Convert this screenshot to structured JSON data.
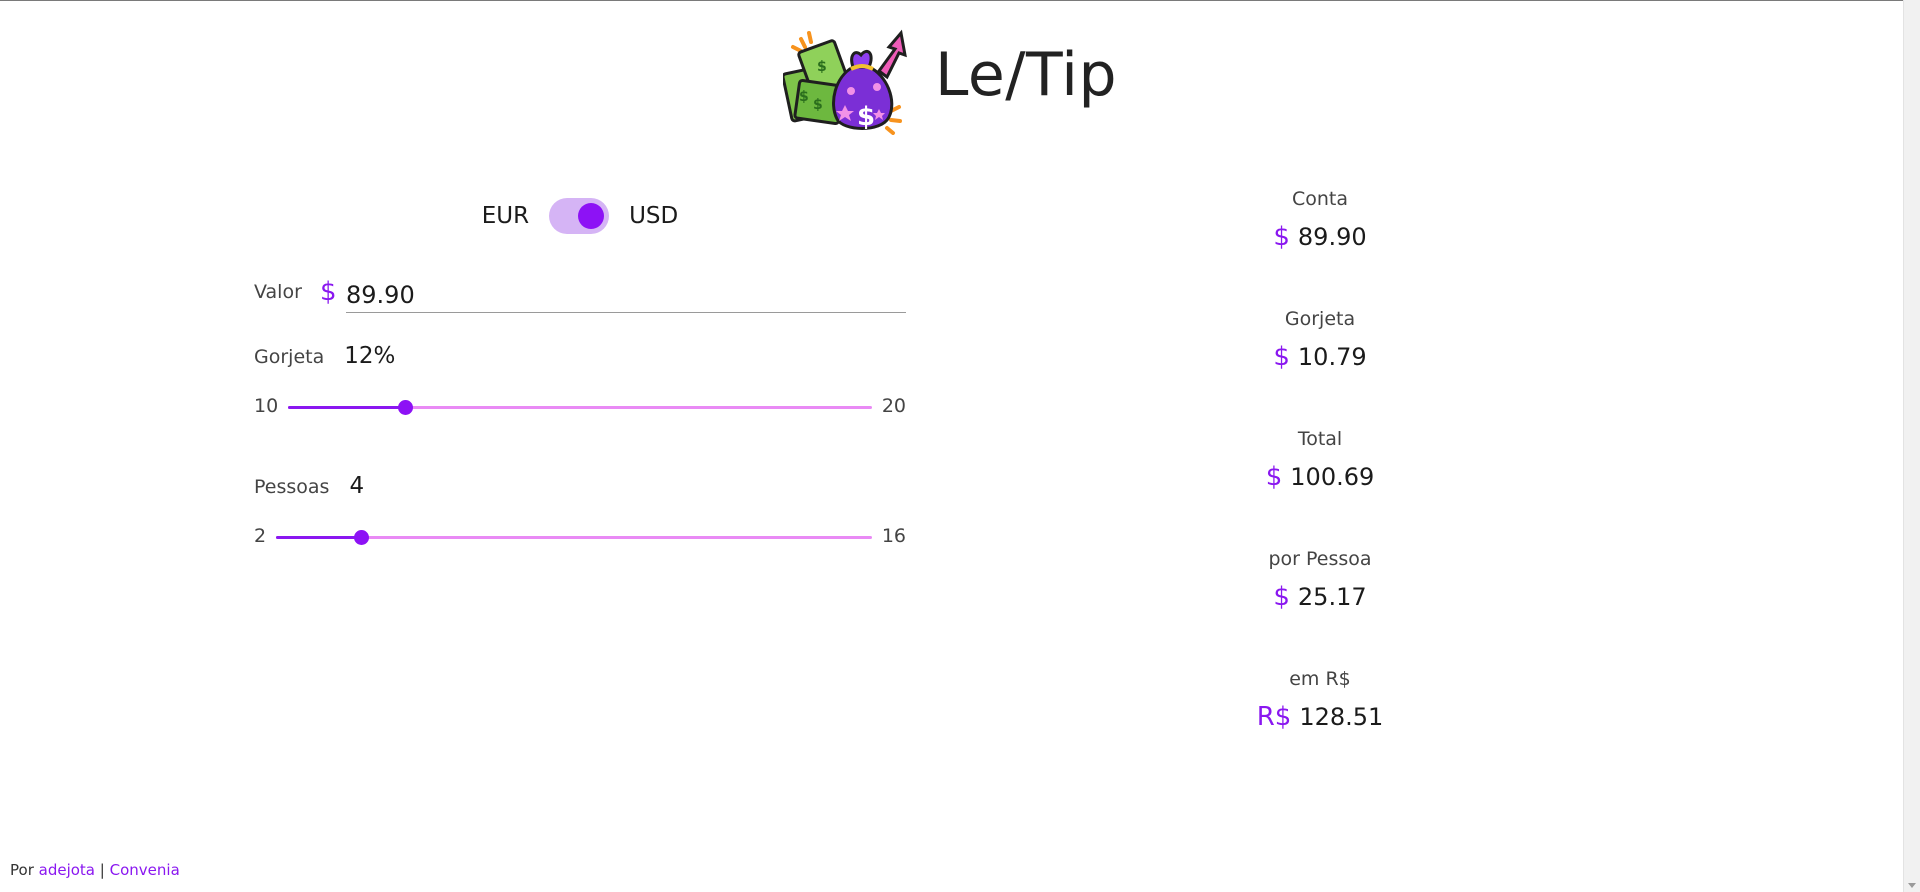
{
  "app": {
    "title": "Le/Tip",
    "logo_icon": "money-bag-icon"
  },
  "currency": {
    "left_label": "EUR",
    "right_label": "USD",
    "selected": "USD"
  },
  "form": {
    "valor": {
      "label": "Valor",
      "currency_symbol": "$",
      "value": "89.90"
    },
    "gorjeta": {
      "label": "Gorjeta",
      "display": "12%",
      "min": "10",
      "max": "20",
      "value": 12
    },
    "pessoas": {
      "label": "Pessoas",
      "display": "4",
      "min": "2",
      "max": "16",
      "value": 4
    }
  },
  "summary": {
    "items": [
      {
        "label": "Conta",
        "currency": "$",
        "value": "89.90"
      },
      {
        "label": "Gorjeta",
        "currency": "$",
        "value": "10.79"
      },
      {
        "label": "Total",
        "currency": "$",
        "value": "100.69"
      },
      {
        "label": "por Pessoa",
        "currency": "$",
        "value": "25.17"
      },
      {
        "label": "em R$",
        "currency": "R$",
        "value": "128.51"
      }
    ]
  },
  "footer": {
    "prefix": "Por",
    "author_link": "adejota",
    "separator": "|",
    "company_link": "Convenia"
  },
  "colors": {
    "accent": "#8a17f0",
    "track": "#e98af5",
    "toggle_bg": "#d5b4f5"
  }
}
